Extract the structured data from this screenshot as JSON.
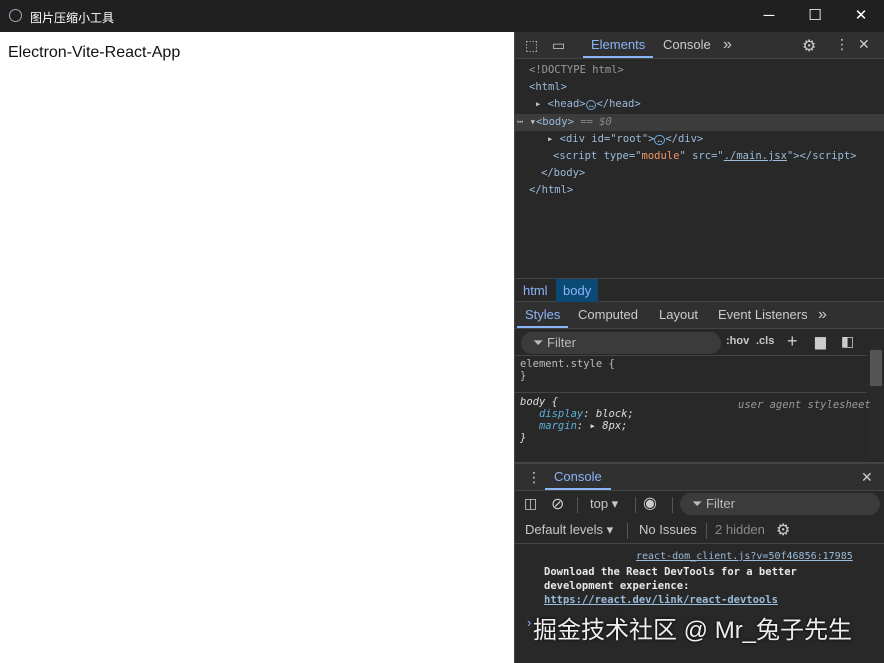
{
  "window": {
    "title": "图片压缩小工具",
    "minimize": "─",
    "maximize": "☐",
    "close": "✕"
  },
  "page": {
    "heading": "Electron-Vite-React-App"
  },
  "devtools": {
    "tabs": [
      "Elements",
      "Console"
    ],
    "more": "»",
    "dom": {
      "doctype": "<!DOCTYPE html>",
      "html_open": "<html>",
      "head_open": "<head>",
      "head_close": "</head>",
      "body_open": "<body>",
      "body_sel": "== $0",
      "div_open": "<div id=\"root\">",
      "div_close": "</div>",
      "script_a": "<script type=\"",
      "script_type": "module",
      "script_b": "\" src=\"",
      "script_src": "./main.jsx",
      "script_c": "\"></script>",
      "body_close": "</body>",
      "html_close": "</html>",
      "ellipsis": "…"
    },
    "breadcrumb": [
      "html",
      "body"
    ],
    "style_tabs": [
      "Styles",
      "Computed",
      "Layout",
      "Event Listeners"
    ],
    "styles_filter": "Filter",
    "hov": ":hov",
    "cls": ".cls",
    "rules": {
      "element_style": "element.style {",
      "close": "}",
      "body_sel": "body {",
      "origin": "user agent stylesheet",
      "p1": "display",
      "v1": "block;",
      "p2": "margin",
      "v2": "8px;"
    },
    "console": {
      "title": "Console",
      "context": "top ▾",
      "filter": "Filter",
      "levels": "Default levels ▾",
      "issues": "No Issues",
      "hidden": "2 hidden",
      "source": "react-dom_client.js?v=50f46856:17985",
      "msg1": "Download the React DevTools for a better",
      "msg2": "development experience:",
      "url": "https://react.dev/link/react-devtools",
      "prompt": "›"
    }
  },
  "watermark": "掘金技术社区 @ Mr_兔子先生"
}
